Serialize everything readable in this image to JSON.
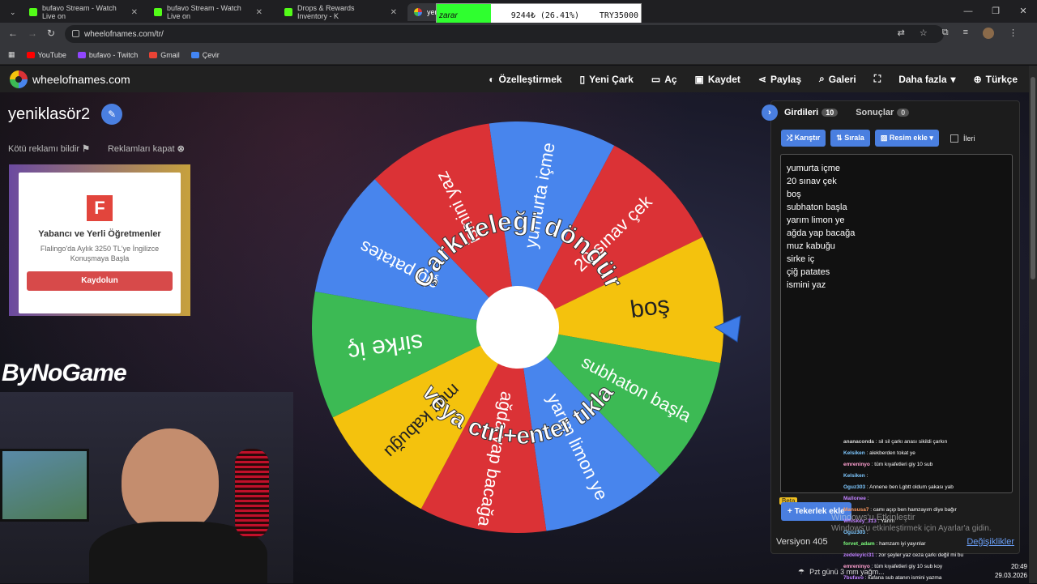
{
  "browser": {
    "tabs": [
      {
        "title": "bufavo Stream - Watch Live on"
      },
      {
        "title": "bufavo Stream - Watch Live on"
      },
      {
        "title": "Drops & Rewards Inventory - K"
      },
      {
        "title": "yen"
      }
    ],
    "url": "wheelofnames.com/tr/",
    "bookmarks": [
      "YouTube",
      "bufavo - Twitch",
      "Gmail",
      "Çevir"
    ]
  },
  "overlay": {
    "label": "zarar",
    "value": "9244₺ (26.41%)",
    "target": "TRY35000"
  },
  "site": {
    "logo": "wheelofnames.com",
    "menu": [
      "Özelleştirmek",
      "Yeni Çark",
      "Aç",
      "Kaydet",
      "Paylaş",
      "Galeri",
      "Daha fazla",
      "Türkçe"
    ]
  },
  "wheel": {
    "title": "yeniklasör2",
    "report_ad": "Kötü reklamı bildir",
    "close_ads": "Reklamları kapat",
    "center_text_top": "Çarkıfeleği döndür",
    "center_text_bottom": "veya ctrl+enter tıkla",
    "segments": [
      {
        "label": "yumurta içme",
        "color": "#4885ed"
      },
      {
        "label": "20 sınav çek",
        "color": "#db3236"
      },
      {
        "label": "boş",
        "color": "#f4c20d"
      },
      {
        "label": "subhaton başla",
        "color": "#3cba54"
      },
      {
        "label": "yarım limon ye",
        "color": "#4885ed"
      },
      {
        "label": "ağda yap bacağa",
        "color": "#db3236"
      },
      {
        "label": "muz kabuğu",
        "color": "#f4c20d"
      },
      {
        "label": "sirke iç",
        "color": "#3cba54"
      },
      {
        "label": "çiğ patates",
        "color": "#4885ed"
      },
      {
        "label": "ismini yaz",
        "color": "#db3236"
      }
    ]
  },
  "ad": {
    "logo_letter": "F",
    "headline": "Yabancı ve Yerli Öğretmenler",
    "body": "Flalingo'da Aylık 3250 TL'ye İngilizce Konuşmaya Başla",
    "cta": "Kaydolun"
  },
  "stream": {
    "brand": "ByNoGame"
  },
  "panel": {
    "tab_entries": "Girdileri",
    "entries_count": "10",
    "tab_results": "Sonuçlar",
    "results_count": "0",
    "shuffle": "Karıştır",
    "sort": "Sırala",
    "add_image": "Resim ekle",
    "advanced": "İleri",
    "entries": [
      "yumurta içme",
      "20 sınav çek",
      "boş",
      "subhaton başla",
      "yarım limon ye",
      "ağda yap bacağa",
      "muz kabuğu",
      "sirke iç",
      "çiğ patates",
      "ismini yaz"
    ],
    "beta": "Beta",
    "add_wheel": "Tekerlek ekle",
    "version": "Versiyon 405",
    "changes": "Değişiklikler"
  },
  "chat": [
    {
      "user": "ananaconda",
      "color": "#d8d8d8",
      "msg": ": sil sil çarkı anası sikildi çarkın"
    },
    {
      "user": "Kelsiken",
      "color": "#7ec8ff",
      "msg": ": alekberden tokat ye"
    },
    {
      "user": "emreninyo",
      "color": "#ffa0d0",
      "msg": ": tüm kıyafetleri giy 10 sub"
    },
    {
      "user": "Kelsiken",
      "color": "#7ec8ff",
      "msg": ":"
    },
    {
      "user": "Oguz303",
      "color": "#7ec8ff",
      "msg": ": Annene ben Lgbtt oldum şakası yab"
    },
    {
      "user": "Mallonee",
      "color": "#c080ff",
      "msg": ":"
    },
    {
      "user": "Mansusa7",
      "color": "#ff9a60",
      "msg": ": camı açıp ben hamzayım diye bağır"
    },
    {
      "user": "Whiskey_313",
      "color": "#c080ff",
      "msg": ": Yarım"
    },
    {
      "user": "Oguz303",
      "color": "#7ec8ff",
      "msg": ":"
    },
    {
      "user": "forvet_adam",
      "color": "#7dff7d",
      "msg": ": hamzam iyi yayınlar"
    },
    {
      "user": "zedeleyici31",
      "color": "#c080ff",
      "msg": ": zor şeyler yaz ceza çarkı değil mi bu"
    },
    {
      "user": "emreninyo",
      "color": "#ffa0d0",
      "msg": ": tüm kıyafetleri giy 10 sub koy"
    },
    {
      "user": "7bufavo",
      "color": "#c080ff",
      "msg": ": kafana sub atanın ismini yazma"
    }
  ],
  "windows": {
    "activate_title": "Windows'u Etkinleştir",
    "activate_sub": "Windows'u etkinleştirmek için Ayarlar'a gidin.",
    "weather": "Pzt günü 3 mm yağm...",
    "time": "20:49",
    "date": "29.03.2026"
  }
}
